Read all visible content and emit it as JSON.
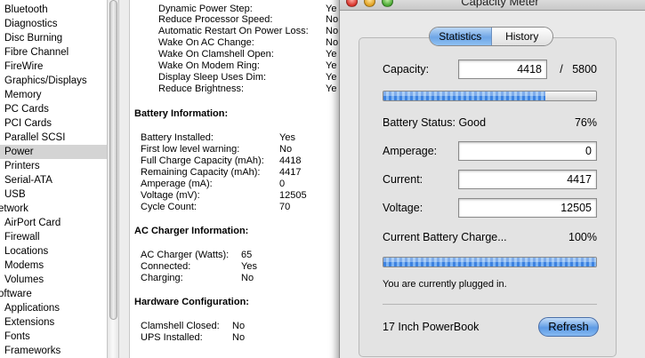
{
  "sidebar": {
    "items": [
      {
        "label": "Bluetooth"
      },
      {
        "label": "Diagnostics"
      },
      {
        "label": "Disc Burning"
      },
      {
        "label": "Fibre Channel"
      },
      {
        "label": "FireWire"
      },
      {
        "label": "Graphics/Displays"
      },
      {
        "label": "Memory"
      },
      {
        "label": "PC Cards"
      },
      {
        "label": "PCI Cards"
      },
      {
        "label": "Parallel SCSI"
      },
      {
        "label": "Power",
        "selected": true
      },
      {
        "label": "Printers"
      },
      {
        "label": "Serial-ATA"
      },
      {
        "label": "USB"
      },
      {
        "label": "etwork",
        "section": true
      },
      {
        "label": "AirPort Card"
      },
      {
        "label": "Firewall"
      },
      {
        "label": "Locations"
      },
      {
        "label": "Modems"
      },
      {
        "label": "Volumes"
      },
      {
        "label": "oftware",
        "section": true
      },
      {
        "label": "Applications"
      },
      {
        "label": "Extensions"
      },
      {
        "label": "Fonts"
      },
      {
        "label": "Frameworks"
      }
    ]
  },
  "power_settings": [
    {
      "label": "Dynamic Power Step:",
      "value": "Ye"
    },
    {
      "label": "Reduce Processor Speed:",
      "value": "No"
    },
    {
      "label": "Automatic Restart On Power Loss:",
      "value": "No"
    },
    {
      "label": "Wake On AC Change:",
      "value": "No"
    },
    {
      "label": "Wake On Clamshell Open:",
      "value": "Ye"
    },
    {
      "label": "Wake On Modem Ring:",
      "value": "Ye"
    },
    {
      "label": "Display Sleep Uses Dim:",
      "value": "Ye"
    },
    {
      "label": "Reduce Brightness:",
      "value": "Ye"
    }
  ],
  "battery_info": {
    "heading": "Battery Information:",
    "rows": [
      {
        "label": "Battery Installed:",
        "value": "Yes"
      },
      {
        "label": "First low level warning:",
        "value": "No"
      },
      {
        "label": "Full Charge Capacity (mAh):",
        "value": "4418"
      },
      {
        "label": "Remaining Capacity (mAh):",
        "value": "4417"
      },
      {
        "label": "Amperage (mA):",
        "value": "0"
      },
      {
        "label": "Voltage (mV):",
        "value": "12505"
      },
      {
        "label": "Cycle Count:",
        "value": "70"
      }
    ]
  },
  "charger_info": {
    "heading": "AC Charger Information:",
    "rows": [
      {
        "label": "AC Charger (Watts):",
        "value": "65"
      },
      {
        "label": "Connected:",
        "value": "Yes"
      },
      {
        "label": "Charging:",
        "value": "No"
      }
    ]
  },
  "hardware_config": {
    "heading": "Hardware Configuration:",
    "rows": [
      {
        "label": "Clamshell Closed:",
        "value": "No"
      },
      {
        "label": "UPS Installed:",
        "value": "No"
      }
    ]
  },
  "capacity_meter": {
    "title": "Capacity Meter",
    "tabs": {
      "statistics": "Statistics",
      "history": "History"
    },
    "capacity_label": "Capacity:",
    "capacity_value": "4418",
    "capacity_separator": "/",
    "capacity_max": "5800",
    "capacity_fill": 0.76,
    "battery_status": "Battery Status: Good",
    "battery_percent": "76%",
    "amperage_label": "Amperage:",
    "amperage_value": "0",
    "current_label": "Current:",
    "current_value": "4417",
    "voltage_label": "Voltage:",
    "voltage_value": "12505",
    "charge_label": "Current Battery Charge...",
    "charge_percent": "100%",
    "charge_fill": 1.0,
    "plugged_message": "You are currently plugged in.",
    "model": "17 Inch PowerBook",
    "refresh_label": "Refresh"
  },
  "colors": {
    "selection": "#d4d4d4",
    "progress_blue": "#3c82e0",
    "window_bg": "#e9e9e9"
  }
}
